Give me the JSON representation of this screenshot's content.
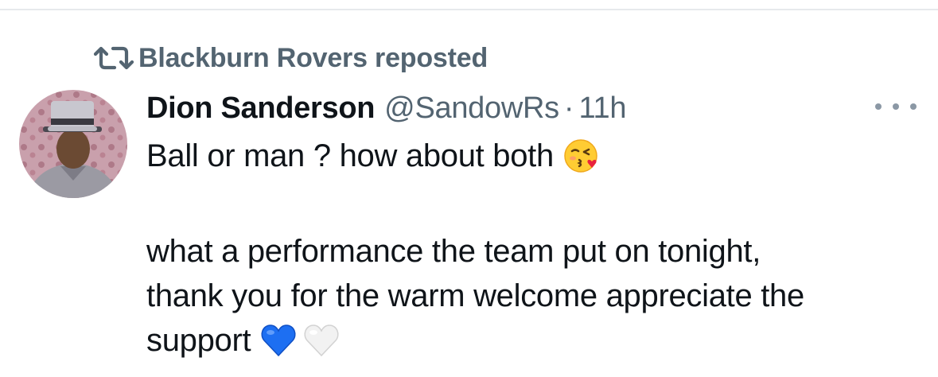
{
  "repost": {
    "icon": "repost-icon",
    "text": "Blackburn Rovers reposted"
  },
  "tweet": {
    "author": {
      "avatar": "avatar",
      "display_name": "Dion Sanderson",
      "handle": "@SandowRs",
      "separator": "·",
      "time": "11h"
    },
    "more_icon": "more-options-icon",
    "lines": {
      "l1": "Ball or man ? how about both",
      "l2": "what a performance the team put on tonight,",
      "l3": "thank you for the warm welcome appreciate the",
      "l4": "support"
    },
    "emojis": [
      "face-blowing-kiss-emoji",
      "blue-heart-emoji",
      "white-heart-emoji"
    ]
  },
  "colors": {
    "primary_text": "#0f1419",
    "secondary_text": "#536471",
    "divider": "#e6e9ec",
    "blue_heart": "#1d6ff2"
  }
}
